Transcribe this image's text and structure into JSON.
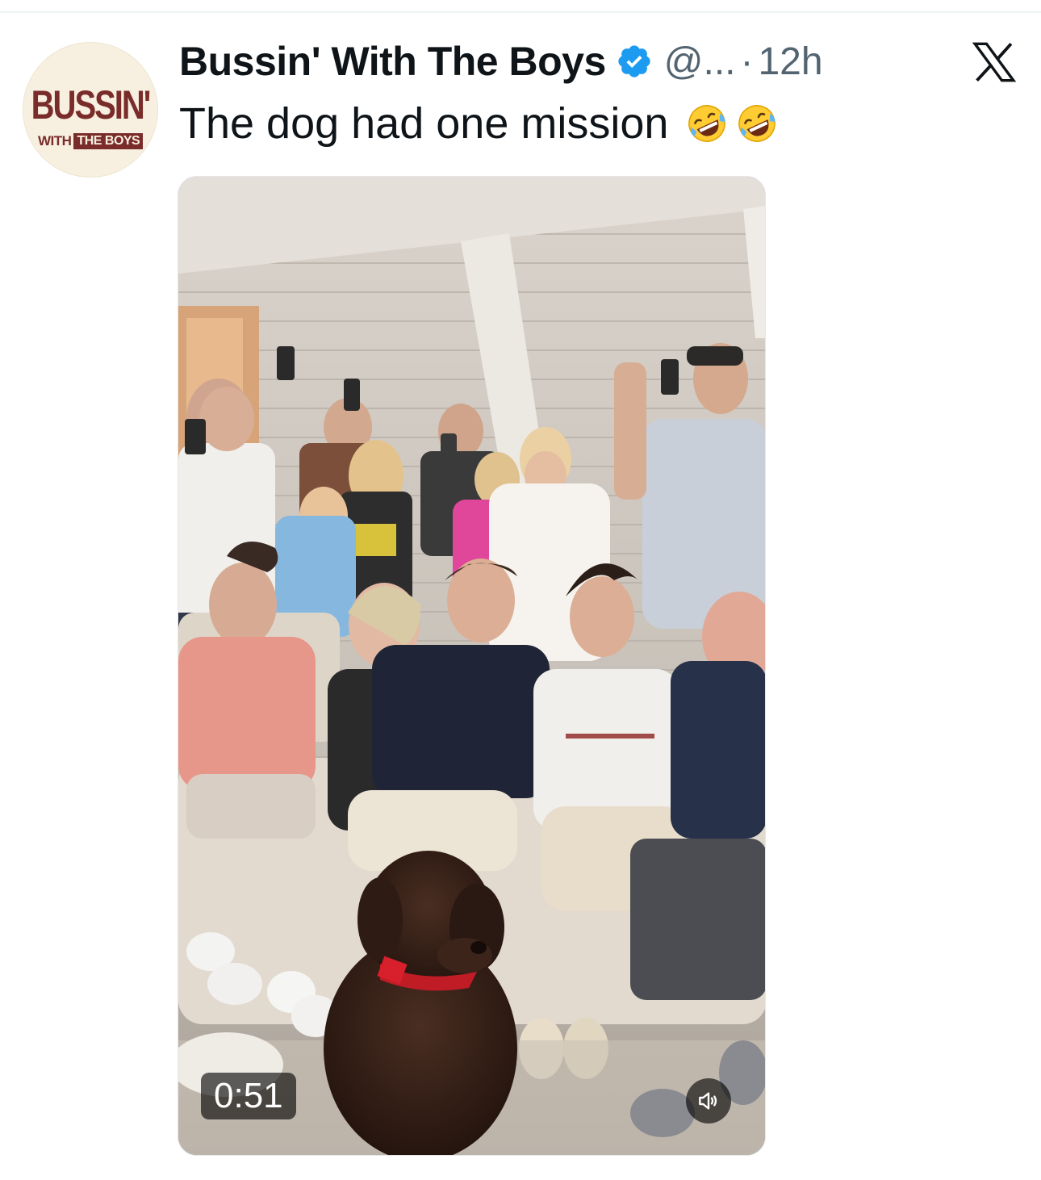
{
  "author": {
    "avatar_logo_top": "BUSSIN'",
    "avatar_logo_with": "WITH",
    "avatar_logo_theboys": "THE BOYS",
    "name": "Bussin' With The Boys",
    "verified_icon": "verified-badge-icon",
    "handle": "@...",
    "separator": "·",
    "time": "12h"
  },
  "platform_icon": "x-logo-icon",
  "tweet": {
    "text": "The dog had one mission",
    "emojis": [
      "rolling-on-floor-laughing-emoji",
      "rolling-on-floor-laughing-emoji"
    ]
  },
  "video": {
    "duration": "0:51",
    "sound_icon": "speaker-muted-icon"
  },
  "colors": {
    "text_primary": "#0f1419",
    "text_secondary": "#536471",
    "verified_blue": "#1d9bf0",
    "brand_maroon": "#7a2c2a"
  }
}
